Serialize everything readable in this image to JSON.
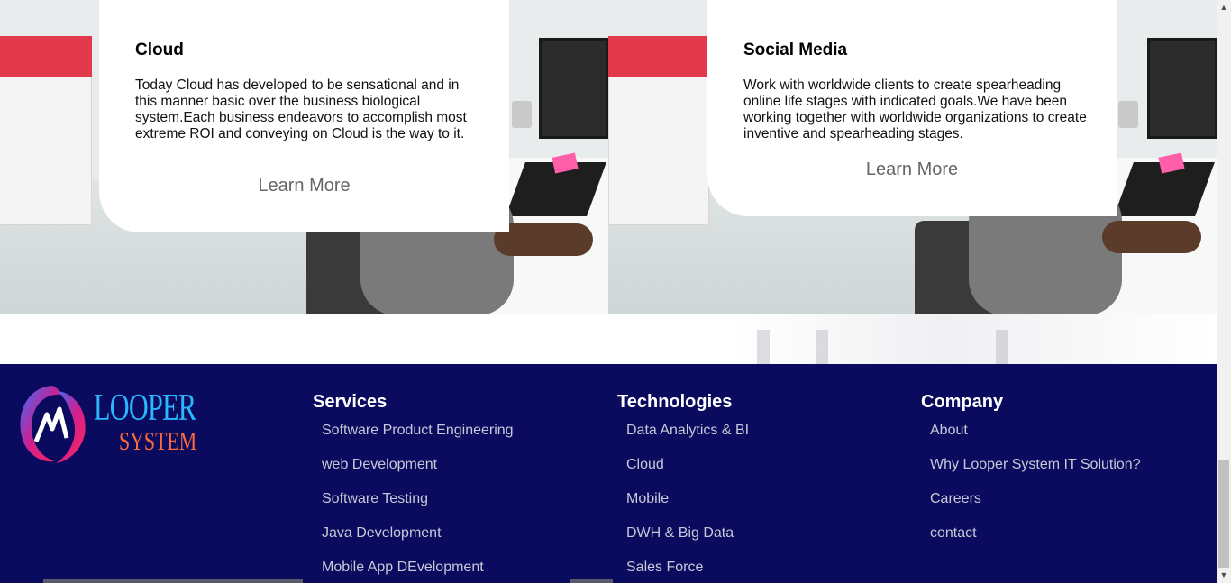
{
  "cards": [
    {
      "title": "Cloud",
      "text": "Today Cloud has developed to be sensational and in this manner basic over the business biological system.Each business endeavors to accomplish most extreme ROI and conveying on Cloud is the way to it.",
      "link": "Learn More"
    },
    {
      "title": "Social Media",
      "text": "Work with worldwide clients to create spearheading online life stages with indicated goals.We have been working together with worldwide organizations to create inventive and spearheading stages.",
      "link": "Learn More"
    }
  ],
  "footer": {
    "logo": {
      "word1": "LOOPER",
      "word2": "SYSTEM"
    },
    "columns": [
      {
        "title": "Services",
        "items": [
          "Software Product Engineering",
          "web Development",
          "Software Testing",
          "Java Development",
          "Mobile App DEvelopment"
        ]
      },
      {
        "title": "Technologies",
        "items": [
          "Data Analytics & BI",
          "Cloud",
          "Mobile",
          "DWH & Big Data",
          "Sales Force"
        ]
      },
      {
        "title": "Company",
        "items": [
          "About",
          "Why Looper System IT Solution?",
          "Careers",
          "contact"
        ]
      }
    ]
  },
  "colors": {
    "footer_bg": "#0a0a5e",
    "footer_link": "#c8c8d8",
    "logo_blue": "#2bb7ff",
    "logo_orange": "#ff6a3a"
  },
  "scrollbar": {
    "up_icon": "triangle-up-icon",
    "down_icon": "triangle-down-icon"
  }
}
